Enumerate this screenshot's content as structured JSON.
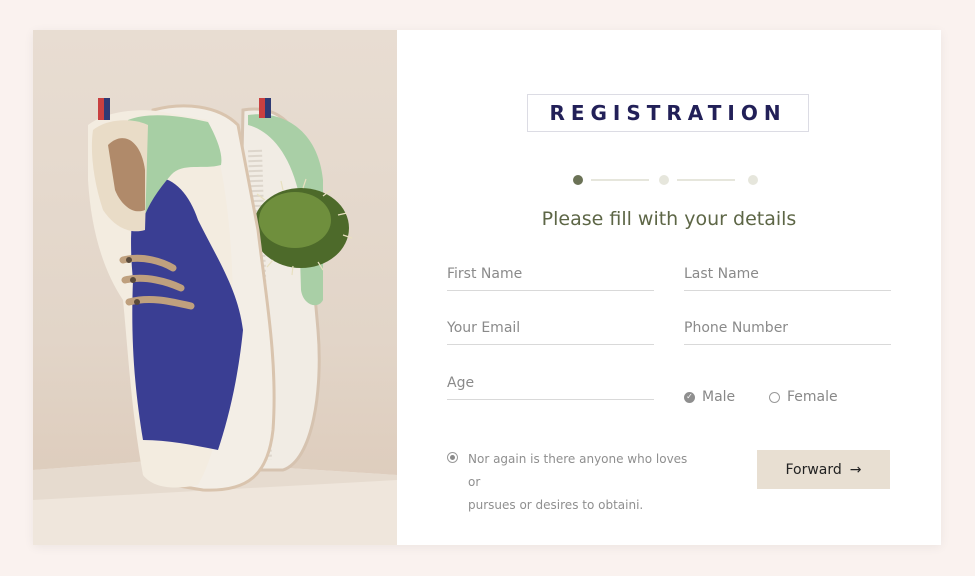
{
  "form": {
    "title": "REGISTRATION",
    "subtitle": "Please fill with your details",
    "steps": {
      "total": 3,
      "current": 1
    },
    "fields": {
      "first_name": {
        "placeholder": "First Name",
        "value": ""
      },
      "last_name": {
        "placeholder": "Last Name",
        "value": ""
      },
      "email": {
        "placeholder": "Your Email",
        "value": ""
      },
      "phone": {
        "placeholder": "Phone Number",
        "value": ""
      },
      "age": {
        "placeholder": "Age",
        "value": ""
      }
    },
    "gender": {
      "options": [
        {
          "label": "Male",
          "selected": true
        },
        {
          "label": "Female",
          "selected": false
        }
      ]
    },
    "agreement": {
      "line1": "Nor again is there anyone who loves or",
      "line2": "pursues or desires to obtaini.",
      "checked": true
    },
    "forward_button": {
      "label": "Forward",
      "arrow": "→"
    }
  },
  "colors": {
    "page_bg": "#faf2ef",
    "title_color": "#222058",
    "accent_olive": "#6b7256",
    "step_inactive": "#e6e6dc",
    "button_bg": "#e8dfd2"
  },
  "image": {
    "subject": "canvas sneaker with cactus",
    "icon": "product-photo"
  }
}
